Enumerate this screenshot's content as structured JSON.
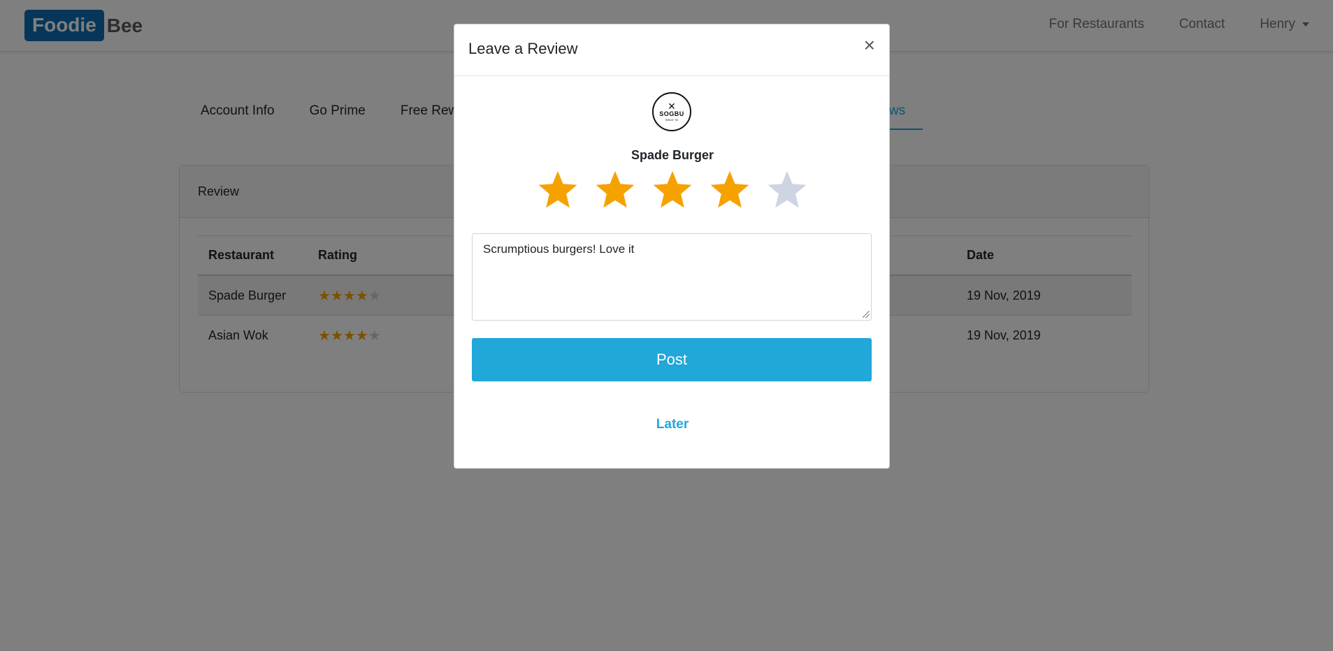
{
  "navbar": {
    "brand_box": "Foodie",
    "brand_rest": "Bee",
    "links": [
      "For Restaurants",
      "Contact"
    ],
    "user_menu": "Henry"
  },
  "tabs": {
    "items": [
      "Account Info",
      "Go Prime",
      "Free Rew"
    ],
    "active_partial": "eviews"
  },
  "card": {
    "header": "Review",
    "columns": [
      "Restaurant",
      "Rating",
      "Date"
    ],
    "rows": [
      {
        "restaurant": "Spade Burger",
        "rating": 4,
        "date": "19 Nov, 2019"
      },
      {
        "restaurant": "Asian Wok",
        "rating": 4,
        "date": "19 Nov, 2019"
      }
    ]
  },
  "modal": {
    "title": "Leave a Review",
    "close": "×",
    "logo_text": "SOGBU",
    "logo_sub": "SINCE '92",
    "restaurant_name": "Spade Burger",
    "rating": 4,
    "rating_max": 5,
    "review_text": "Scrumptious burgers! Love it",
    "post_label": "Post",
    "later_label": "Later"
  },
  "colors": {
    "brand": "#0d6eb5",
    "accent": "#21a7d8",
    "star_on": "#f5a200",
    "star_off": "#cfd4e2"
  }
}
